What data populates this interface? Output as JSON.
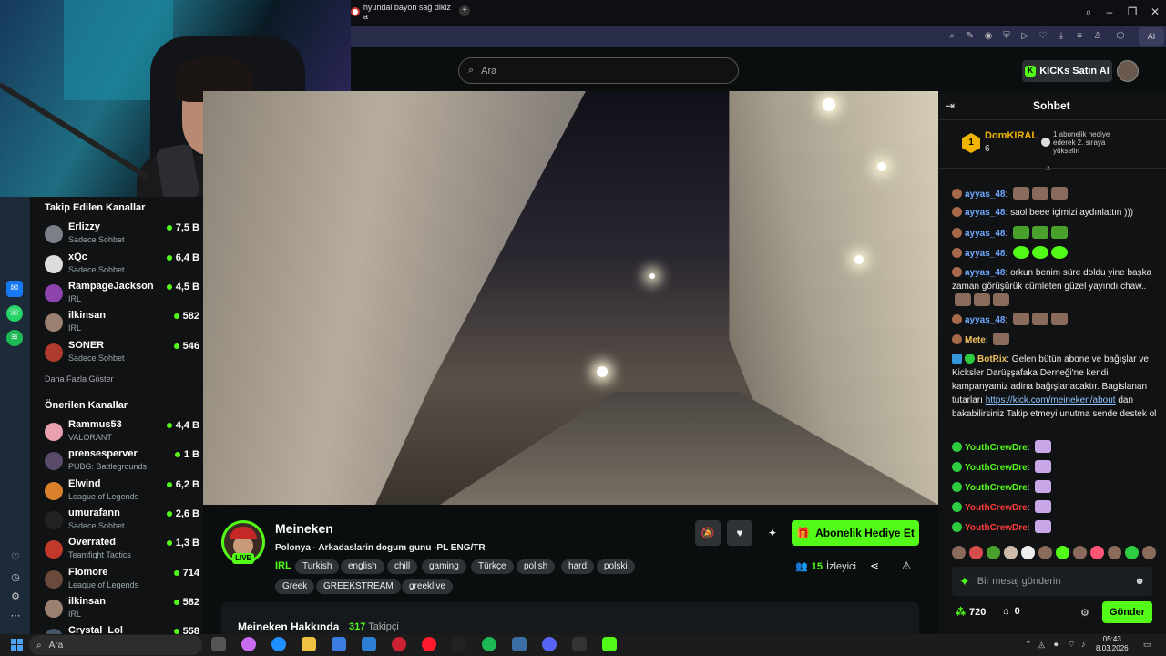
{
  "browser": {
    "tab_title": "hyundai bayon sağ dikiz a",
    "new_tab": "+",
    "ai_label": "AI"
  },
  "header": {
    "search_placeholder": "Ara",
    "kicks_button": "KICKs Satın Al"
  },
  "sidebar": {
    "followed_title": "Takip Edilen Kanallar",
    "followed": [
      {
        "name": "Erlizzy",
        "category": "Sadece Sohbet",
        "viewers": "7,5 B"
      },
      {
        "name": "xQc",
        "category": "Sadece Sohbet",
        "viewers": "6,4 B"
      },
      {
        "name": "RampageJackson",
        "category": "IRL",
        "viewers": "4,5 B"
      },
      {
        "name": "ilkinsan",
        "category": "IRL",
        "viewers": "582"
      },
      {
        "name": "SONER",
        "category": "Sadece Sohbet",
        "viewers": "546"
      }
    ],
    "show_more": "Daha Fazla Göster",
    "recommended_title": "Önerilen Kanallar",
    "recommended": [
      {
        "name": "Rammus53",
        "category": "VALORANT",
        "viewers": "4,4 B"
      },
      {
        "name": "prensesperver",
        "category": "PUBG: Battlegrounds",
        "viewers": "1 B"
      },
      {
        "name": "Elwind",
        "category": "League of Legends",
        "viewers": "6,2 B"
      },
      {
        "name": "umurafann",
        "category": "Sadece Sohbet",
        "viewers": "2,6 B"
      },
      {
        "name": "Overrated",
        "category": "Teamfight Tactics",
        "viewers": "1,3 B"
      },
      {
        "name": "Flomore",
        "category": "League of Legends",
        "viewers": "714"
      },
      {
        "name": "ilkinsan",
        "category": "IRL",
        "viewers": "582"
      },
      {
        "name": "Crystal_Lol",
        "category": "",
        "viewers": "558"
      }
    ]
  },
  "stream": {
    "streamer": "Meineken",
    "live_label": "LIVE",
    "title": "Polonya - Arkadaslarin dogum gunu -PL ENG/TR",
    "category": "IRL",
    "tags_row1": [
      "Turkish",
      "english",
      "chill",
      "gaming",
      "Türkçe",
      "polish",
      "hard",
      "polski"
    ],
    "tags_row2": [
      "Greek",
      "GREEKSTREAM",
      "greeklive"
    ],
    "gift_button": "Abonelik Hediye Et",
    "viewer_count": "15",
    "viewer_label": "İzleyici",
    "about_title": "Meineken Hakkında",
    "follower_count": "317",
    "follower_label": "Takipçi"
  },
  "chat": {
    "title": "Sohbet",
    "top_gifter": {
      "rank": "1",
      "name": "DomKIRAL",
      "count": "6",
      "note": "1 abonelik hediye ederek 2. sıraya yükselin"
    },
    "messages": [
      {
        "user": "ayyas_48",
        "text": ""
      },
      {
        "user": "ayyas_48",
        "text": "saol beee içimizi aydınlattın )))"
      },
      {
        "user": "ayyas_48",
        "text": ""
      },
      {
        "user": "ayyas_48",
        "text": ""
      },
      {
        "user": "ayyas_48",
        "text": "orkun benim süre doldu yine başka zaman görüşürük cümleten güzel yayındı chaw.."
      },
      {
        "user": "ayyas_48",
        "text": ""
      },
      {
        "user": "Mete",
        "text": ""
      },
      {
        "user": "BotRix",
        "text": "Gelen bütün abone ve bağışlar ve Kicksler Darüşşafaka Derneği'ne kendi kampanyamiz adina bağışlanacaktır. Bagislanan tutarları",
        "link": "https://kick.com/meineken/about",
        "text2": "dan bakabilirsiniz Takip etmeyi unutma sende destek ol"
      },
      {
        "user": "YouthCrewDre",
        "text": ""
      },
      {
        "user": "YouthCrewDre",
        "text": ""
      },
      {
        "user": "YouthCrewDre",
        "text": ""
      },
      {
        "user": "YouthCrewDre",
        "text": ""
      },
      {
        "user": "YouthCrewDre",
        "text": ""
      }
    ],
    "input_placeholder": "Bir mesaj gönderin",
    "points": "720",
    "store_count": "0",
    "send_button": "Gönder"
  },
  "taskbar": {
    "search": "Ara",
    "time": "05:43",
    "date": "8.03.2026"
  },
  "colors": {
    "accent": "#53fc18",
    "gold": "#f0b400"
  }
}
